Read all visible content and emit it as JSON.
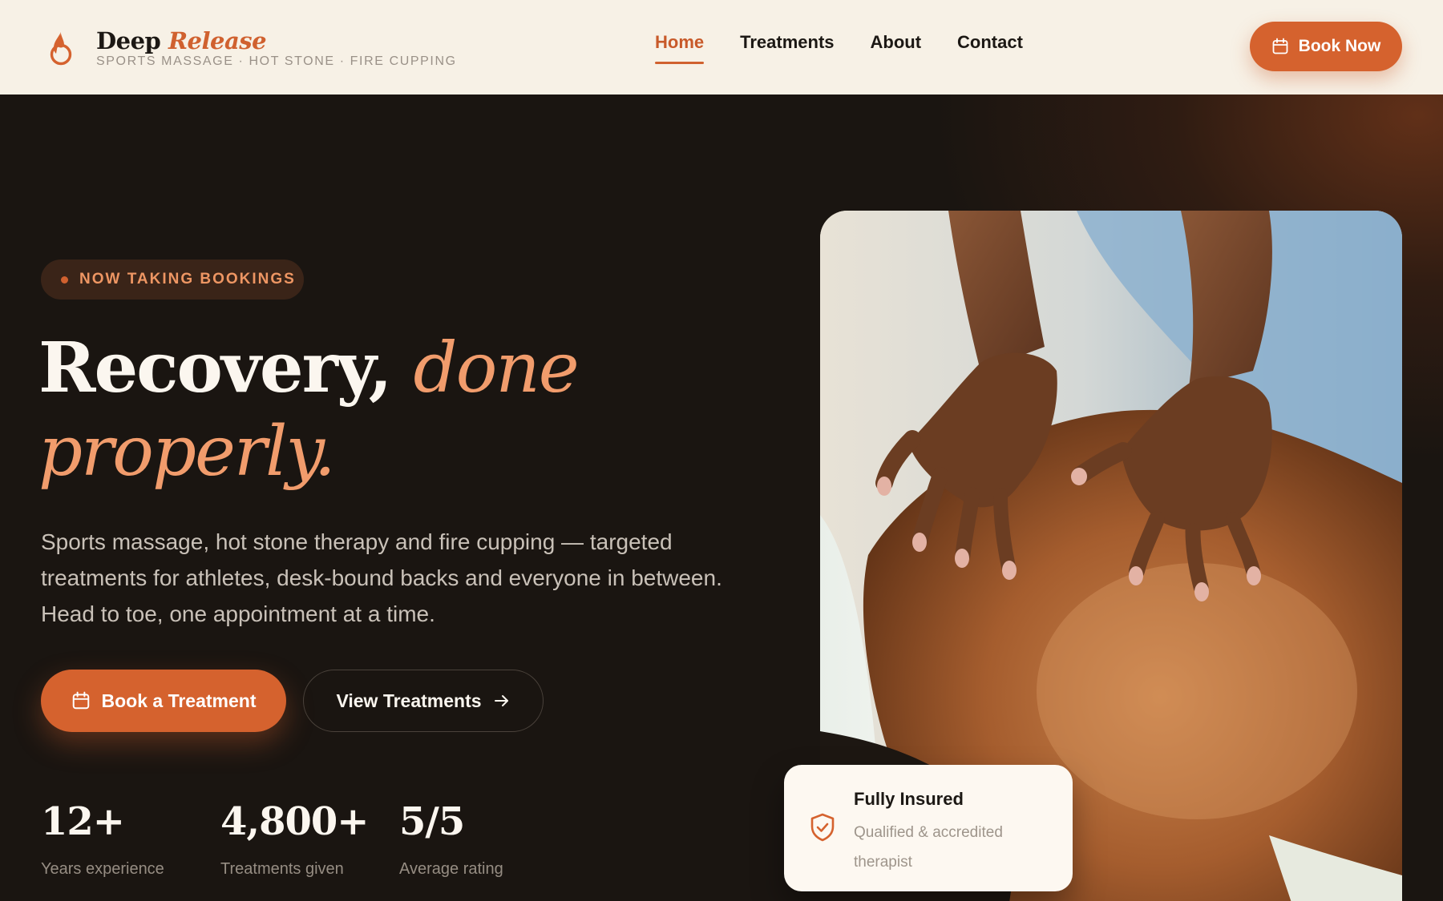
{
  "brand": {
    "name": "Deep",
    "name_accent": "Release",
    "tagline": "SPORTS MASSAGE · HOT STONE · FIRE CUPPING"
  },
  "nav": {
    "items": [
      {
        "label": "Home",
        "active": true
      },
      {
        "label": "Treatments",
        "active": false
      },
      {
        "label": "About",
        "active": false
      },
      {
        "label": "Contact",
        "active": false
      }
    ],
    "cta": "Book Now"
  },
  "hero": {
    "badge": "NOW TAKING BOOKINGS",
    "headline_plain": "Recovery,",
    "headline_accent_1": "done",
    "headline_accent_2": "properly.",
    "lead": "Sports massage, hot stone therapy and fire cupping — targeted treatments for athletes, desk-bound backs and everyone in between. Head to toe, one appointment at a time.",
    "primary_button": "Book a Treatment",
    "secondary_button": "View Treatments",
    "stats": [
      {
        "value": "12+",
        "label": "Years experience"
      },
      {
        "value": "4,800+",
        "label": "Treatments given"
      },
      {
        "value": "5/5",
        "label": "Average rating"
      }
    ]
  },
  "insured_card": {
    "title": "Fully Insured",
    "subtitle": "Qualified & accredited therapist"
  },
  "colors": {
    "accent": "#d5622e",
    "accent_light": "#f19c6c",
    "header_bg": "#f7f1e6",
    "hero_bg": "#1a1511"
  },
  "icons": {
    "logo": "flame-drop-icon",
    "calendar": "calendar-icon",
    "arrow": "arrow-right-icon",
    "shield": "shield-check-icon"
  }
}
